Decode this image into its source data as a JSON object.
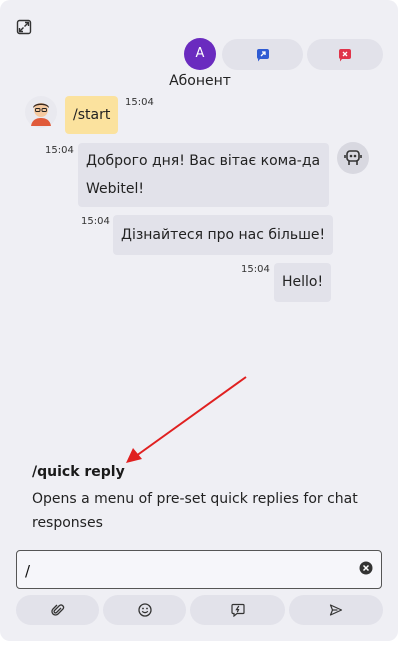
{
  "header": {
    "avatar_letter": "A",
    "contact_name": "Абонент"
  },
  "messages": [
    {
      "from": "user",
      "text": "/start",
      "time": "15:04"
    },
    {
      "from": "bot",
      "text_line1": "Доброго дня! Вас вітає кома-да",
      "text_line2": "Webitel!",
      "time": "15:04"
    },
    {
      "from": "bot",
      "text": "Дізнайтеся про нас більше!",
      "time": "15:04"
    },
    {
      "from": "bot",
      "text": "Hello!",
      "time": "15:04"
    }
  ],
  "hint": {
    "title": "/quick reply",
    "description": "Opens a menu of pre-set quick replies for chat responses"
  },
  "composer": {
    "value": "/"
  },
  "colors": {
    "accent": "#2f5bd3",
    "danger": "#e0344a",
    "avatar": "#6a2bbf",
    "user_bubble": "#fbe29e",
    "arrow": "#e02020"
  }
}
